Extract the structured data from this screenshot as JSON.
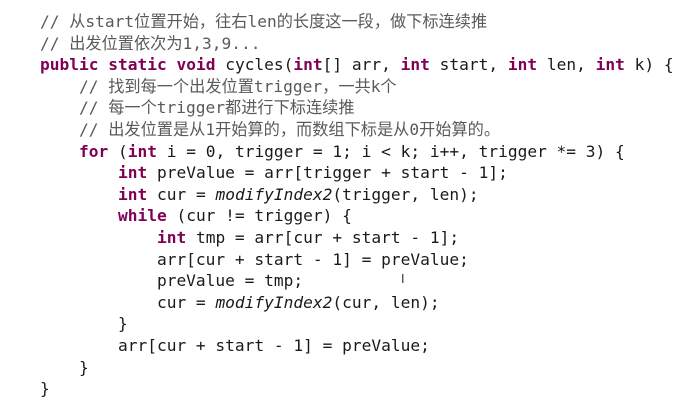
{
  "colors": {
    "keyword": "#7f0055",
    "comment": "#5a5a5a",
    "text": "#1a1a1a",
    "background": "#ffffff"
  },
  "cursor_icon": "text-cursor-ibeam",
  "cursor_glyph": "I",
  "code_lines": [
    [
      {
        "t": "// 从start位置开始，往右len的长度这一段，做下标连续推",
        "c": "cm"
      }
    ],
    [
      {
        "t": "// 出发位置依次为1,3,9...",
        "c": "cm"
      }
    ],
    [
      {
        "t": "public",
        "c": "kw"
      },
      {
        "t": " ",
        "c": "txt"
      },
      {
        "t": "static",
        "c": "kw"
      },
      {
        "t": " ",
        "c": "txt"
      },
      {
        "t": "void",
        "c": "kw"
      },
      {
        "t": " cycles(",
        "c": "txt"
      },
      {
        "t": "int",
        "c": "kw"
      },
      {
        "t": "[] arr, ",
        "c": "txt"
      },
      {
        "t": "int",
        "c": "kw"
      },
      {
        "t": " start, ",
        "c": "txt"
      },
      {
        "t": "int",
        "c": "kw"
      },
      {
        "t": " len, ",
        "c": "txt"
      },
      {
        "t": "int",
        "c": "kw"
      },
      {
        "t": " k) {",
        "c": "txt"
      }
    ],
    [
      {
        "t": "    // 找到每一个出发位置trigger，一共k个",
        "c": "cm"
      }
    ],
    [
      {
        "t": "    // 每一个trigger都进行下标连续推",
        "c": "cm"
      }
    ],
    [
      {
        "t": "    // 出发位置是从1开始算的，而数组下标是从0开始算的。",
        "c": "cm"
      }
    ],
    [
      {
        "t": "    ",
        "c": "txt"
      },
      {
        "t": "for",
        "c": "kw"
      },
      {
        "t": " (",
        "c": "txt"
      },
      {
        "t": "int",
        "c": "kw"
      },
      {
        "t": " i = 0, trigger = 1; i < k; i++, trigger *= 3) {",
        "c": "txt"
      }
    ],
    [
      {
        "t": "        ",
        "c": "txt"
      },
      {
        "t": "int",
        "c": "kw"
      },
      {
        "t": " preValue = arr[trigger + start - 1];",
        "c": "txt"
      }
    ],
    [
      {
        "t": "        ",
        "c": "txt"
      },
      {
        "t": "int",
        "c": "kw"
      },
      {
        "t": " cur = ",
        "c": "txt"
      },
      {
        "t": "modifyIndex2",
        "c": "it"
      },
      {
        "t": "(trigger, len);",
        "c": "txt"
      }
    ],
    [
      {
        "t": "        ",
        "c": "txt"
      },
      {
        "t": "while",
        "c": "kw"
      },
      {
        "t": " (cur != trigger) {",
        "c": "txt"
      }
    ],
    [
      {
        "t": "            ",
        "c": "txt"
      },
      {
        "t": "int",
        "c": "kw"
      },
      {
        "t": " tmp = arr[cur + start - 1];",
        "c": "txt"
      }
    ],
    [
      {
        "t": "            arr[cur + start - 1] = preValue;",
        "c": "txt"
      }
    ],
    [
      {
        "t": "            preValue = tmp;",
        "c": "txt"
      }
    ],
    [
      {
        "t": "            cur = ",
        "c": "txt"
      },
      {
        "t": "modifyIndex2",
        "c": "it"
      },
      {
        "t": "(cur, len);",
        "c": "txt"
      }
    ],
    [
      {
        "t": "        }",
        "c": "txt"
      }
    ],
    [
      {
        "t": "        arr[cur + start - 1] = preValue;",
        "c": "txt"
      }
    ],
    [
      {
        "t": "    }",
        "c": "txt"
      }
    ],
    [
      {
        "t": "}",
        "c": "txt"
      }
    ]
  ]
}
